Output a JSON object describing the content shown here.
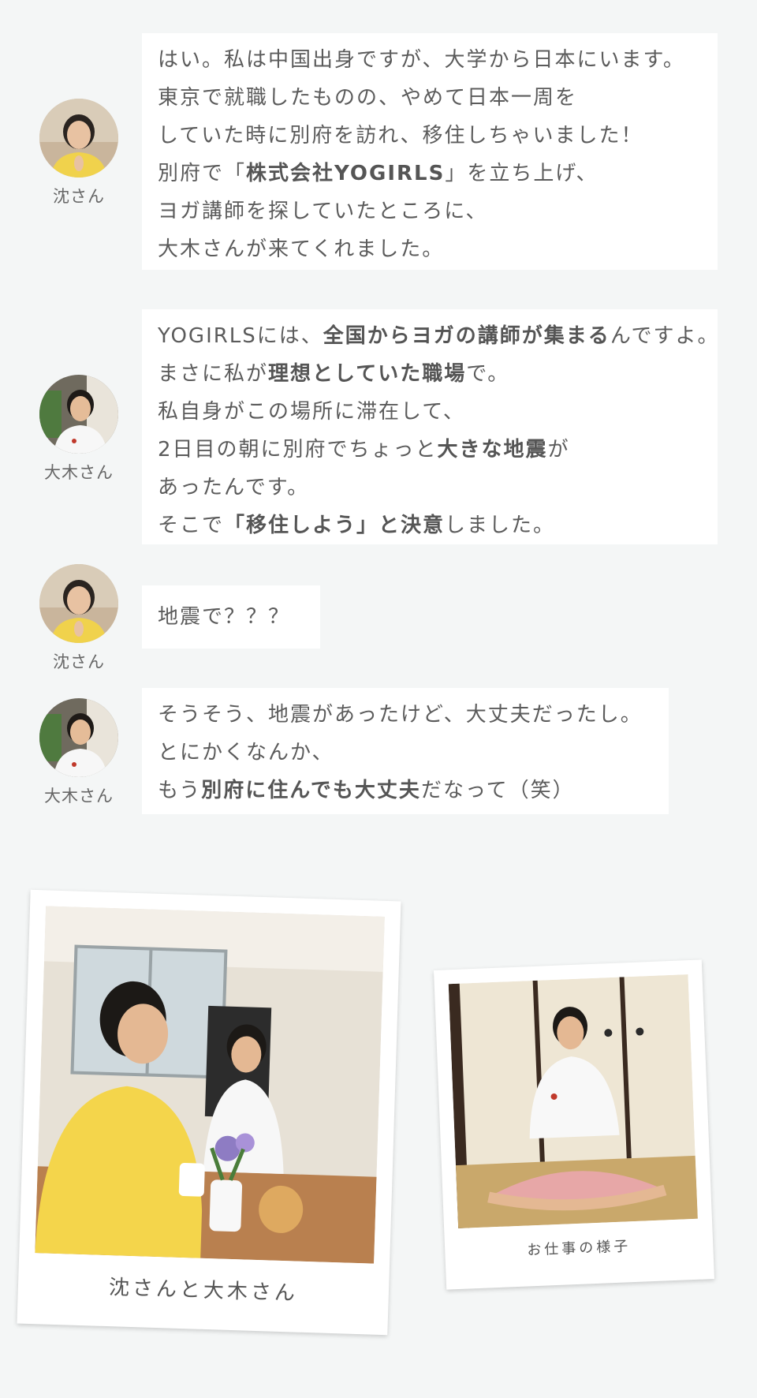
{
  "messages": [
    {
      "speaker": "沈さん",
      "lines": [
        [
          {
            "t": "はい。私は中国出身ですが、大学から日本にいます。"
          }
        ],
        [
          {
            "t": "東京で就職したものの、やめて日本一周を"
          }
        ],
        [
          {
            "t": "していた時に別府を訪れ、移住しちゃいました！"
          }
        ],
        [
          {
            "t": "別府で「"
          },
          {
            "t": "株式会社YOGIRLS",
            "b": true
          },
          {
            "t": "」を立ち上げ、"
          }
        ],
        [
          {
            "t": "ヨガ講師を探していたところに、"
          }
        ],
        [
          {
            "t": "大木さんが来てくれました。"
          }
        ]
      ]
    },
    {
      "speaker": "大木さん",
      "lines": [
        [
          {
            "t": "YOGIRLSには、"
          },
          {
            "t": "全国からヨガの講師が集まる",
            "b": true
          },
          {
            "t": "んですよ。"
          }
        ],
        [
          {
            "t": "まさに私が"
          },
          {
            "t": "理想としていた職場",
            "b": true
          },
          {
            "t": "で。"
          }
        ],
        [
          {
            "t": "私自身がこの場所に滞在して、"
          }
        ],
        [
          {
            "t": "2日目の朝に別府でちょっと"
          },
          {
            "t": "大きな地震",
            "b": true
          },
          {
            "t": "が"
          }
        ],
        [
          {
            "t": "あったんです。"
          }
        ],
        [
          {
            "t": "そこで"
          },
          {
            "t": "「移住しよう」と決意",
            "b": true
          },
          {
            "t": "しました。"
          }
        ]
      ]
    },
    {
      "speaker": "沈さん",
      "lines": [
        [
          {
            "t": "地震で？？？"
          }
        ]
      ]
    },
    {
      "speaker": "大木さん",
      "lines": [
        [
          {
            "t": "そうそう、地震があったけど、大丈夫だったし。"
          }
        ],
        [
          {
            "t": "とにかくなんか、"
          }
        ],
        [
          {
            "t": "もう"
          },
          {
            "t": "別府に住んでも大丈夫",
            "b": true
          },
          {
            "t": "だなって（笑）"
          }
        ]
      ]
    }
  ],
  "photos": [
    {
      "caption": "沈さんと大木さん"
    },
    {
      "caption": "お仕事の様子"
    }
  ],
  "colors": {
    "background": "#f4f6f6",
    "bubble": "#ffffff",
    "text": "#5b5b5b"
  }
}
